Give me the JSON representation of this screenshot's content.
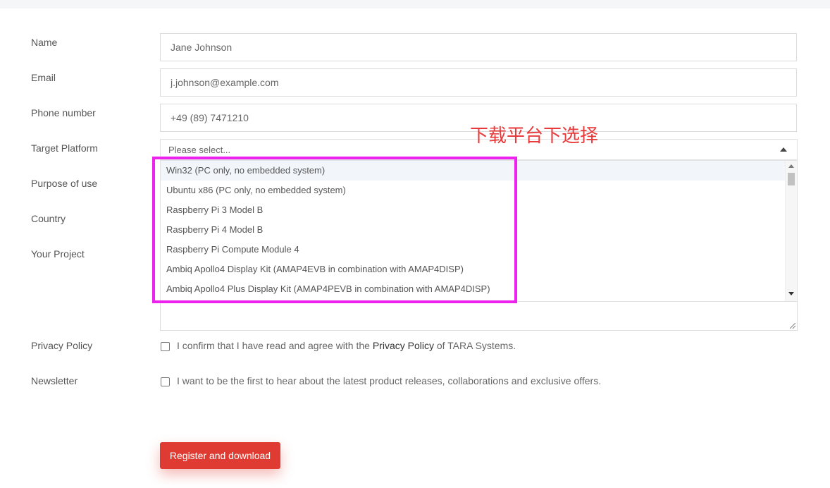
{
  "form": {
    "name": {
      "label": "Name",
      "value": "Jane Johnson"
    },
    "email": {
      "label": "Email",
      "value": "j.johnson@example.com"
    },
    "phone": {
      "label": "Phone number",
      "value": "+49 (89) 7471210"
    },
    "target_platform": {
      "label": "Target Platform",
      "placeholder": "Please select...",
      "options": [
        "Win32 (PC only, no embedded system)",
        "Ubuntu x86 (PC only, no embedded system)",
        "Raspberry Pi 3 Model B",
        "Raspberry Pi 4 Model B",
        "Raspberry Pi Compute Module 4",
        "Ambiq Apollo4 Display Kit (AMAP4EVB in combination with AMAP4DISP)",
        "Ambiq Apollo4 Plus Display Kit (AMAP4PEVB in combination with AMAP4DISP)"
      ]
    },
    "purpose": {
      "label": "Purpose of use"
    },
    "country": {
      "label": "Country"
    },
    "project": {
      "label": "Your Project"
    },
    "privacy": {
      "label": "Privacy Policy",
      "text_before": "I confirm that I have read and agree with the ",
      "link": "Privacy Policy",
      "text_after": " of TARA Systems."
    },
    "newsletter": {
      "label": "Newsletter",
      "text": "I want to be the first to hear about the latest product releases, collaborations and exclusive offers."
    },
    "submit_label": "Register and download"
  },
  "annotation": {
    "text": "下载平台下选择",
    "color": "#e83a3a",
    "box_color": "#ee22ee"
  },
  "colors": {
    "accent": "#e03b32"
  }
}
